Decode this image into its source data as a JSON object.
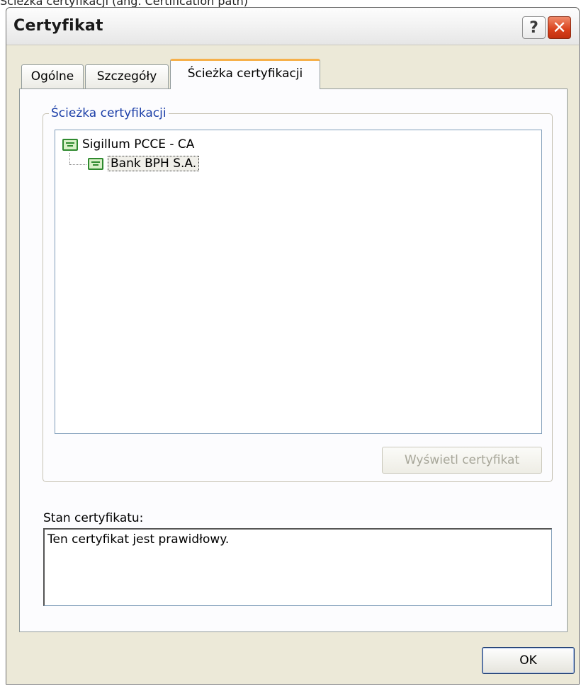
{
  "page_caption": "Ścieżka certyfikacji (ang. Certification path)",
  "window": {
    "title": "Certyfikat",
    "help_label": "?",
    "close_label": "✕"
  },
  "tabs": [
    {
      "label": "Ogólne",
      "selected": false
    },
    {
      "label": "Szczegóły",
      "selected": false
    },
    {
      "label": "Ścieżka certyfikacji",
      "selected": true
    }
  ],
  "path_group": {
    "legend": "Ścieżka certyfikacji",
    "tree": [
      {
        "label": "Sigillum PCCE - CA",
        "icon": "certificate-icon",
        "level": 0,
        "selected": false
      },
      {
        "label": "Bank BPH S.A.",
        "icon": "certificate-icon",
        "level": 1,
        "selected": true
      }
    ],
    "view_button_label": "Wyświetl certyfikat",
    "view_button_enabled": false
  },
  "status": {
    "label": "Stan certyfikatu:",
    "text": "Ten certyfikat jest prawidłowy."
  },
  "ok_label": "OK",
  "colors": {
    "dialog_bg": "#ece9d8",
    "active_tab_accent": "#f6b04a",
    "group_legend": "#1c3fa8",
    "close_button": "#d9411c",
    "certificate_icon": "#2f8a2f"
  }
}
